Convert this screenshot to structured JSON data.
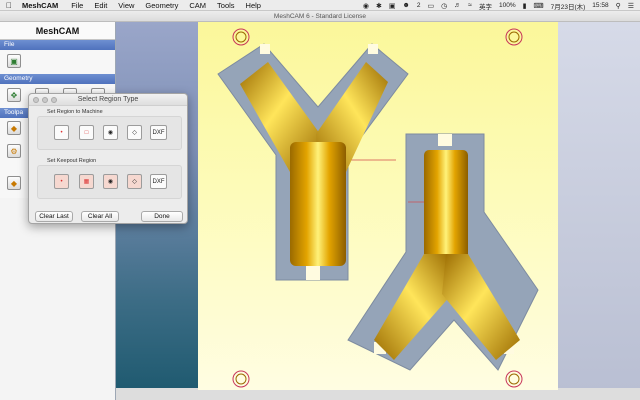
{
  "menubar": {
    "apple_icon": "apple-logo",
    "app_name": "MeshCAM",
    "menus": [
      "File",
      "Edit",
      "View",
      "Geometry",
      "CAM",
      "Tools",
      "Help"
    ],
    "status": {
      "badge_count": "2",
      "input_method": "英字",
      "battery": "100%",
      "date": "7月23日(木)",
      "time": "15:58"
    }
  },
  "window": {
    "title": "MeshCAM 6 - Standard License"
  },
  "panel": {
    "app_name": "MeshCAM",
    "sections": {
      "file": "File",
      "geometry": "Geometry",
      "toolpaths": "Toolpa"
    }
  },
  "dialog": {
    "title": "Select Region Type",
    "machine_label": "Set Region to Machine",
    "keepout_label": "Set Keepout Region",
    "dxf": "DXF",
    "clear_last": "Clear Last",
    "clear_all": "Clear All",
    "done": "Done"
  },
  "colors": {
    "part_gold": "#e3a400",
    "part_highlight": "#fff27a",
    "boundary_gray": "#95a4b8",
    "stock_yellow": "#fbf79a",
    "section_blue": "#5577c3"
  }
}
